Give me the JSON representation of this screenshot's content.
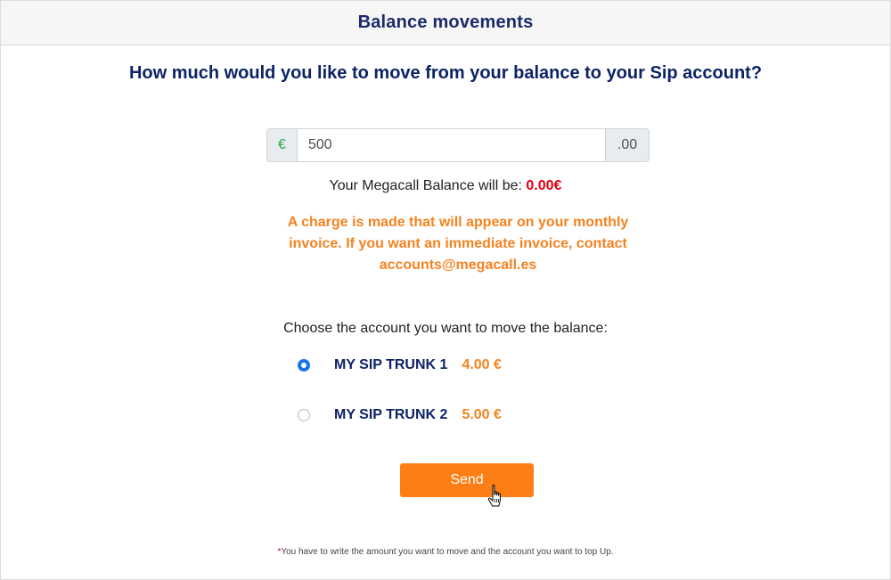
{
  "header": {
    "title": "Balance movements"
  },
  "question": "How much would you like to move from your balance to your Sip account?",
  "amount": {
    "currency_symbol": "€",
    "value": "500",
    "decimals_suffix": ".00"
  },
  "balance": {
    "label": "Your Megacall Balance will be:",
    "value": "0.00€"
  },
  "notice": "A charge is made that will appear on your monthly invoice. If you want an immediate invoice, contact accounts@megacall.es",
  "choose_label": "Choose the account you want to move the balance:",
  "accounts": [
    {
      "name": "MY SIP TRUNK 1",
      "balance": "4.00 €",
      "selected": true
    },
    {
      "name": "MY SIP TRUNK 2",
      "balance": "5.00 €",
      "selected": false
    }
  ],
  "send_label": "Send",
  "footnote": {
    "star": "*",
    "text": "You have to write the amount you want to move and the account you want to top Up."
  },
  "colors": {
    "title_navy": "#0d2366",
    "accent_orange": "#fd7e14",
    "notice_orange": "#f5821f",
    "balance_red": "#e3000f",
    "radio_blue": "#1a73e8"
  }
}
